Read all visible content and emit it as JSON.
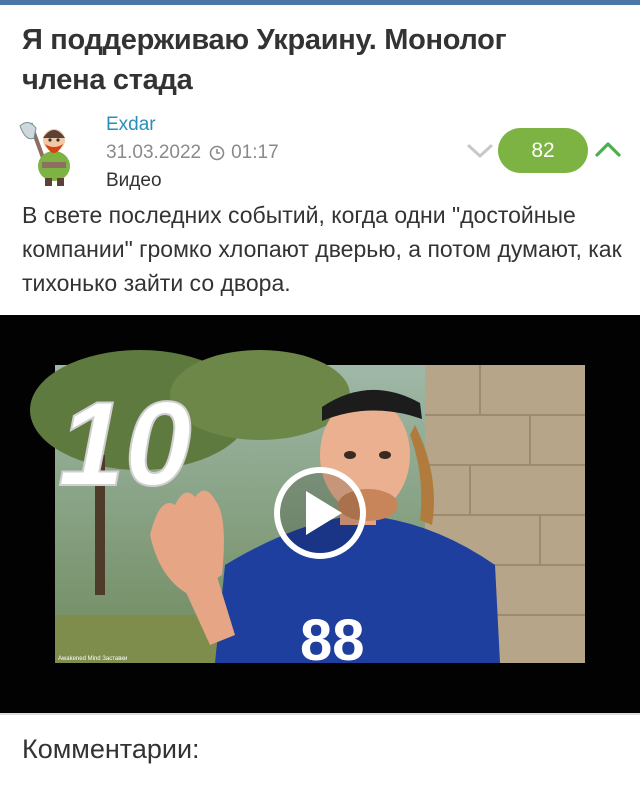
{
  "post": {
    "title": "Я поддерживаю Украину. Монолог члена стада",
    "author": "Exdar",
    "date": "31.03.2022",
    "time": "01:17",
    "category": "Видео",
    "rating": "82",
    "lead": "В свете последних событий, когда одни \"достойные компании\" громко хлопают дверью, а потом думают, как тихонько зайти со двора."
  },
  "video": {
    "overlay_number": "10",
    "caption": "Awakened Mind Заставки"
  },
  "comments": {
    "heading": "Комментарии:"
  },
  "colors": {
    "accent_link": "#2a8fb8",
    "rating_bg": "#7cb342",
    "top_bar": "#4a76a8"
  },
  "icons": [
    "clock-icon",
    "chevron-down-icon",
    "chevron-up-icon",
    "play-icon"
  ]
}
